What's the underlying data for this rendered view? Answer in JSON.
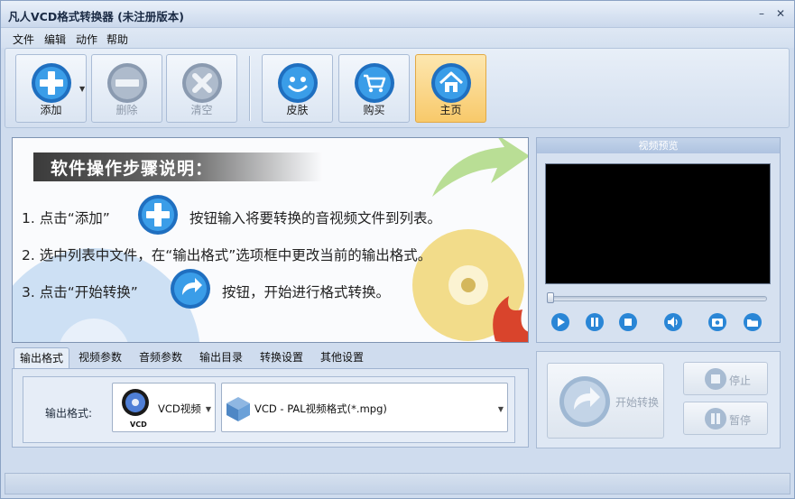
{
  "window": {
    "title": "凡人VCD格式转换器  (未注册版本)",
    "minimize_icon": "–",
    "close_icon": "✕"
  },
  "menu": {
    "items": [
      "文件",
      "编辑",
      "动作",
      "帮助"
    ]
  },
  "toolbar": {
    "buttons": [
      {
        "label": "添加",
        "icon": "plus-icon",
        "enabled": true
      },
      {
        "label": "删除",
        "icon": "minus-icon",
        "enabled": false
      },
      {
        "label": "清空",
        "icon": "clear-icon",
        "enabled": false
      },
      {
        "label": "皮肤",
        "icon": "smiley-icon",
        "enabled": true
      },
      {
        "label": "购买",
        "icon": "cart-icon",
        "enabled": true
      },
      {
        "label": "主页",
        "icon": "home-icon",
        "enabled": true,
        "active": true
      }
    ]
  },
  "guide": {
    "title": "软件操作步骤说明：",
    "step1_a": "1. 点击“添加”",
    "step1_b": "按钮输入将要转换的音视频文件到列表。",
    "step2": "2. 选中列表中文件，在“输出格式”选项框中更改当前的输出格式。",
    "step3_a": "3. 点击“开始转换”",
    "step3_b": "按钮，开始进行格式转换。"
  },
  "preview": {
    "title": "视频预览",
    "position": 0
  },
  "tabs": {
    "items": [
      "输出格式",
      "视频参数",
      "音频参数",
      "输出目录",
      "转换设置",
      "其他设置"
    ],
    "active": 0
  },
  "output": {
    "label": "输出格式:",
    "device_text": "VCD视频",
    "device_badge": "VCD",
    "format_text": "VCD - PAL视频格式(*.mpg)"
  },
  "conversion": {
    "start_label": "开始转换",
    "stop_label": "停止",
    "pause_label": "暂停"
  },
  "colors": {
    "active_button": "#f8c96a",
    "accent_blue": "#2a86d6",
    "video_bg": "#000000"
  }
}
